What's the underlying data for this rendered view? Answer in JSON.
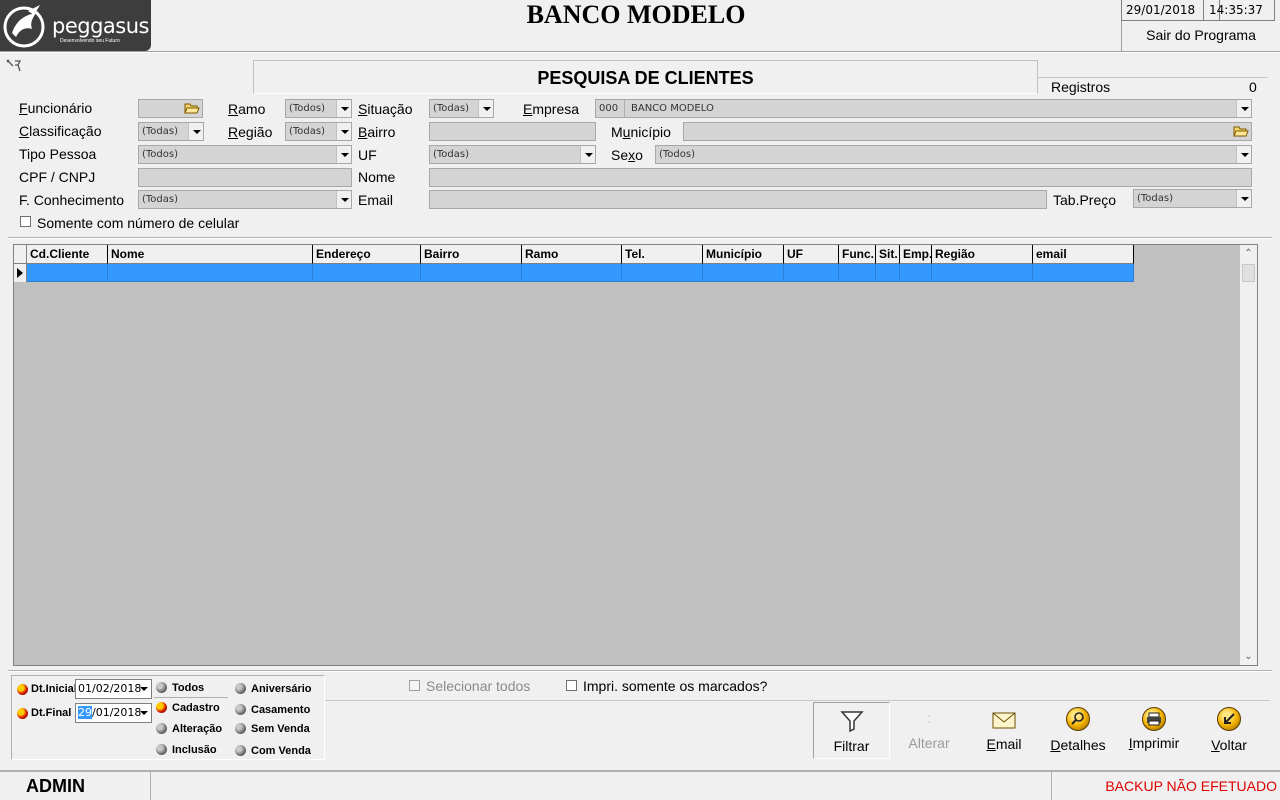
{
  "header": {
    "brand": "peggasus",
    "tagline": "Desenvolvendo seu Futuro",
    "app_title": "BANCO MODELO",
    "date": "29/01/2018",
    "time": "14:35:37",
    "exit_label": "Sair do Programa"
  },
  "page": {
    "title": "PESQUISA DE CLIENTES",
    "records_label": "Registros",
    "records_count": "0"
  },
  "filters": {
    "funcionario": {
      "label_u": "F",
      "label_rest": "uncionário"
    },
    "ramo": {
      "label_u": "R",
      "label_rest": "amo",
      "value": "(Todos)"
    },
    "situacao": {
      "label_u": "S",
      "label_rest": "ituação",
      "value": "(Todas)"
    },
    "empresa": {
      "label_u": "E",
      "label_rest": "mpresa",
      "code": "000",
      "value": "BANCO MODELO"
    },
    "classificacao": {
      "label_u": "C",
      "label_rest": "lassificação",
      "value": "(Todas)"
    },
    "regiao": {
      "label_u": "R",
      "label_rest": "egião",
      "value": "(Todas)"
    },
    "bairro": {
      "label_u": "B",
      "label_rest": "airro"
    },
    "municipio": {
      "label_pre": "M",
      "label_u": "u",
      "label_rest": "nicípio"
    },
    "tipo_pessoa": {
      "label": "Tipo Pessoa",
      "value": "(Todos)"
    },
    "uf": {
      "label": "UF",
      "value": "(Todas)"
    },
    "sexo": {
      "label_pre": "Se",
      "label_u": "x",
      "label_rest": "o",
      "value": "(Todos)"
    },
    "cpf_cnpj": {
      "label": "CPF / CNPJ"
    },
    "nome": {
      "label": "Nome"
    },
    "f_conhecimento": {
      "label": "F. Conhecimento",
      "value": "(Todas)"
    },
    "email": {
      "label": "Email"
    },
    "tab_preco": {
      "label": "Tab.Preço",
      "value": "(Todas)"
    },
    "somente_celular": {
      "label": "Somente com número de celular",
      "checked": false
    }
  },
  "grid": {
    "columns": [
      "Cd.Cliente",
      "Nome",
      "Endereço",
      "Bairro",
      "Ramo",
      "Tel.",
      "Município",
      "UF",
      "Func.",
      "Sit.",
      "Emp.",
      "Região",
      "email"
    ],
    "rows": [],
    "selected_row_color": "#3399ff"
  },
  "dates": {
    "inicial_label": "Dt.Inicial",
    "inicial_value": "01/02/2018",
    "final_label": "Dt.Final",
    "final_value_sel": "29",
    "final_value_rest": "/01/2018"
  },
  "date_filter_options": [
    {
      "label": "Todos",
      "selected": false
    },
    {
      "label": "Cadastro",
      "selected": true
    },
    {
      "label": "Alteração",
      "selected": false
    },
    {
      "label": "Inclusão",
      "selected": false
    }
  ],
  "date_type_options": [
    {
      "label": "Aniversário"
    },
    {
      "label": "Casamento"
    },
    {
      "label": "Sem Venda"
    },
    {
      "label": "Com Venda"
    }
  ],
  "options": {
    "selecionar_todos": "Selecionar todos",
    "impri_marcados": "Impri. somente os marcados?"
  },
  "toolbar": {
    "filtrar": "Filtrar",
    "alterar": "Alterar",
    "email": {
      "u": "E",
      "rest": "mail"
    },
    "detalhes": {
      "u": "D",
      "rest": "etalhes"
    },
    "imprimir": {
      "u": "I",
      "rest": "mprimir"
    },
    "voltar": {
      "u": "V",
      "rest": "oltar"
    }
  },
  "status": {
    "user": "ADMIN",
    "backup": "BACKUP NÃO EFETUADO",
    "backup_color": "#e00000"
  }
}
